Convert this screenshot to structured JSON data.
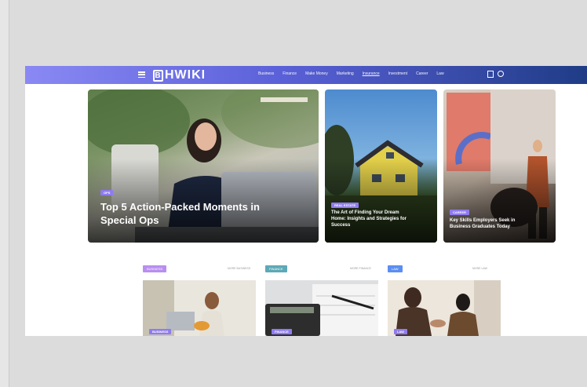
{
  "brand": {
    "logo_mark": "B",
    "logo_text": "HWIKI"
  },
  "nav": {
    "items": [
      "Business",
      "Finance",
      "Make Money",
      "Marketing",
      "Insurance",
      "Investment",
      "Career",
      "Law"
    ],
    "active": "Insurance"
  },
  "hero": {
    "main": {
      "tag": "OPS",
      "title_line1": "Top 5 Action-Packed Moments in",
      "title_line2": "Special Ops"
    },
    "second": {
      "tag": "REAL ESTATE",
      "title_line1": "The Art of Finding Your Dream",
      "title_line2": "Home: Insights and Strategies for",
      "title_line3": "Success"
    },
    "third": {
      "tag": "CAREER",
      "title_line1": "Key Skills Employers Seek in",
      "title_line2": "Business Graduates Today"
    }
  },
  "sections": [
    {
      "label": "BUSINESS",
      "more": "MORE BUSINESS",
      "card_tag": "BUSINESS",
      "color": "#b98ef0"
    },
    {
      "label": "FINANCE",
      "more": "MORE FINANCE",
      "card_tag": "FINANCE",
      "color": "#5da9b7"
    },
    {
      "label": "LAW",
      "more": "MORE LAW",
      "card_tag": "LAW",
      "color": "#5b8ef2"
    }
  ],
  "colors": {
    "nav_start": "#8a89f4",
    "nav_end": "#1f3c86",
    "tag": "#8f7bef"
  },
  "icons": [
    "menu-icon",
    "bookmark-icon",
    "search-icon"
  ]
}
